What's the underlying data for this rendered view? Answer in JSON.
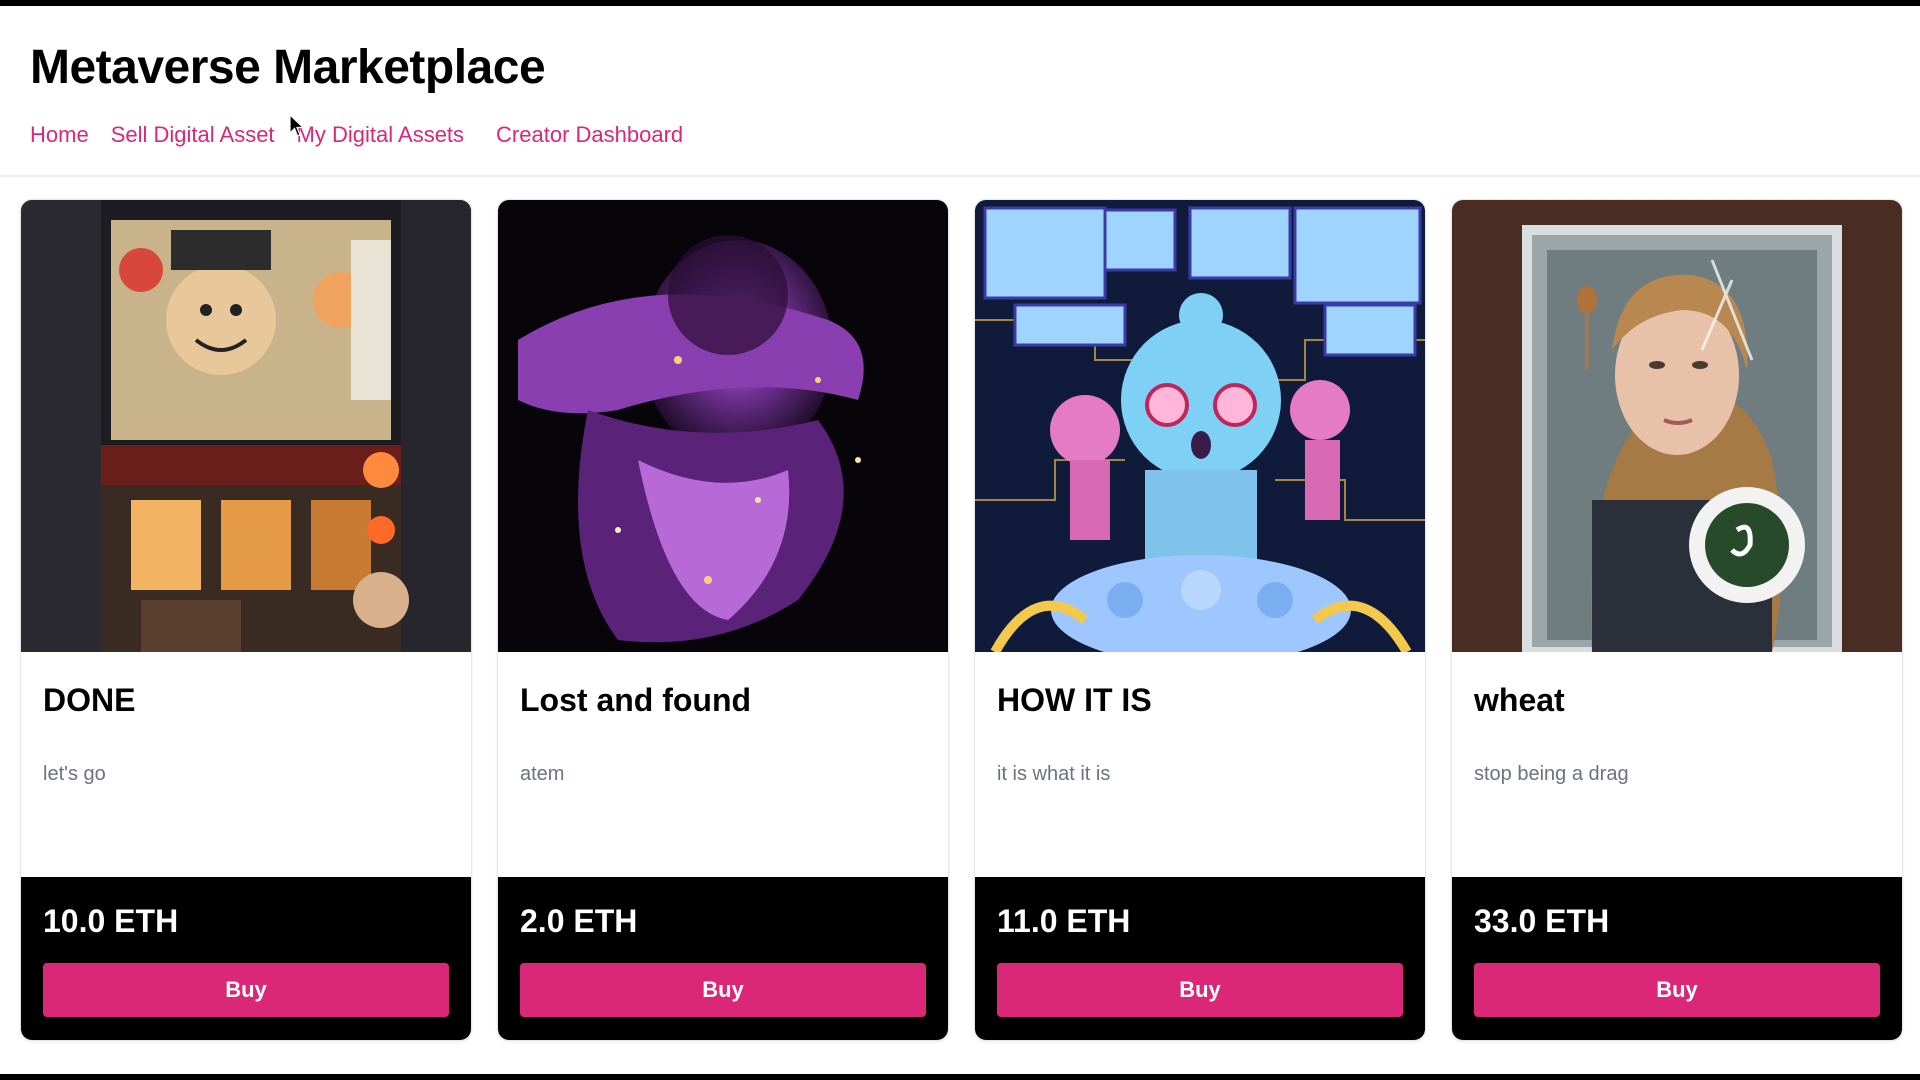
{
  "header": {
    "title": "Metaverse Marketplace",
    "nav": [
      {
        "label": "Home"
      },
      {
        "label": "Sell Digital Asset"
      },
      {
        "label": "My Digital Assets"
      },
      {
        "label": "Creator Dashboard"
      }
    ]
  },
  "items": [
    {
      "name": "DONE",
      "description": "let's go",
      "price": "10.0 ETH",
      "buy_label": "Buy",
      "image": "illustrated-street-shop-artwork"
    },
    {
      "name": "Lost and found",
      "description": "atem",
      "price": "2.0 ETH",
      "buy_label": "Buy",
      "image": "glitter-figure-artwork"
    },
    {
      "name": "HOW IT IS",
      "description": "it is what it is",
      "price": "11.0 ETH",
      "buy_label": "Buy",
      "image": "pixel-art-character-artwork"
    },
    {
      "name": "wheat",
      "description": "stop being a drag",
      "price": "33.0 ETH",
      "buy_label": "Buy",
      "image": "portrait-behind-glass-artwork"
    }
  ],
  "colors": {
    "accent": "#db2777",
    "price_bar": "#000000",
    "description": "#6b7280"
  }
}
